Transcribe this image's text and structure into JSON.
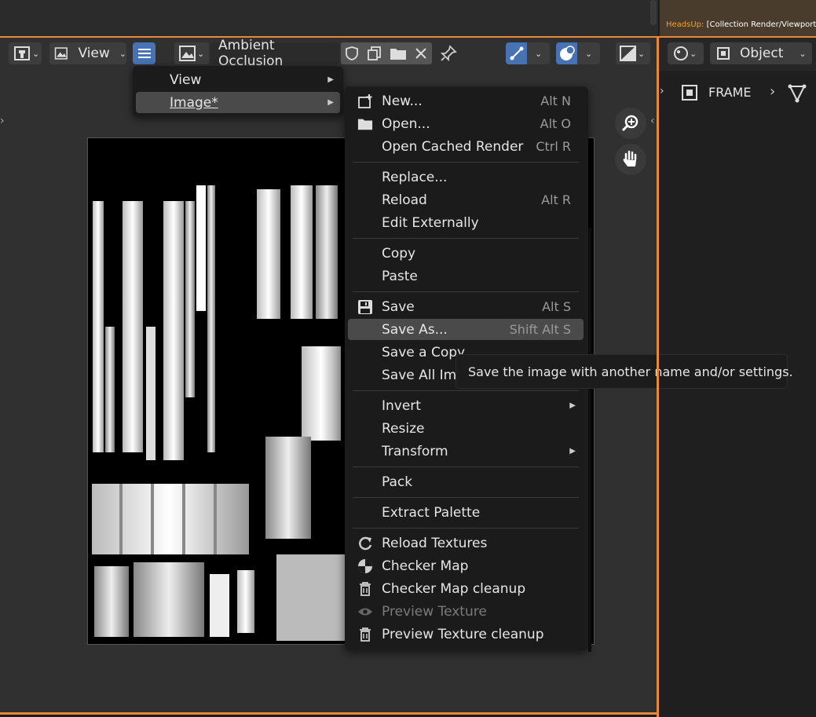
{
  "top_area": {
    "heads_up_label": "HeadsUp:",
    "heads_up_text": "[Collection Render/Viewport"
  },
  "header": {
    "view_menu_label": "View",
    "image_name": "Ambient Occlusion"
  },
  "right_panel": {
    "object_mode_label": "Object",
    "breadcrumb_label": "FRAME"
  },
  "menu_level1": {
    "items": [
      {
        "label": "View"
      },
      {
        "label": "Image*"
      }
    ]
  },
  "image_menu": {
    "items": [
      {
        "label": "New...",
        "shortcut": "Alt N",
        "icon": "new-image-icon"
      },
      {
        "label": "Open...",
        "shortcut": "Alt O",
        "icon": "folder-icon"
      },
      {
        "label": "Open Cached Render",
        "shortcut": "Ctrl R"
      },
      {
        "label": "Replace...",
        "shortcut": ""
      },
      {
        "label": "Reload",
        "shortcut": "Alt R"
      },
      {
        "label": "Edit Externally",
        "shortcut": ""
      },
      {
        "label": "Copy",
        "shortcut": ""
      },
      {
        "label": "Paste",
        "shortcut": ""
      },
      {
        "label": "Save",
        "shortcut": "Alt S",
        "icon": "floppy-icon"
      },
      {
        "label": "Save As...",
        "shortcut": "Shift Alt S"
      },
      {
        "label": "Save a Copy",
        "shortcut": ""
      },
      {
        "label": "Save All Ima",
        "shortcut": ""
      },
      {
        "label": "Invert",
        "shortcut": ""
      },
      {
        "label": "Resize",
        "shortcut": ""
      },
      {
        "label": "Transform",
        "shortcut": ""
      },
      {
        "label": "Pack",
        "shortcut": ""
      },
      {
        "label": "Extract Palette",
        "shortcut": ""
      },
      {
        "label": "Reload Textures",
        "shortcut": "",
        "icon": "reload-icon"
      },
      {
        "label": "Checker Map",
        "shortcut": "",
        "icon": "checker-icon"
      },
      {
        "label": "Checker Map cleanup",
        "shortcut": "",
        "icon": "trash-icon"
      },
      {
        "label": "Preview Texture",
        "shortcut": "",
        "icon": "eye-icon"
      },
      {
        "label": "Preview Texture cleanup",
        "shortcut": "",
        "icon": "trash-icon"
      }
    ]
  },
  "tooltip": {
    "text": "Save the image with another name and/or settings."
  },
  "colors": {
    "accent_orange": "#e8893a",
    "active_blue": "#4772b3",
    "menu_bg": "#1b1b1b",
    "highlight": "#4a4a4a"
  }
}
